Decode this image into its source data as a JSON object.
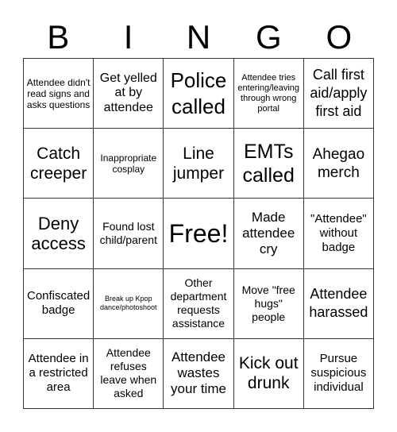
{
  "header": {
    "letters": [
      "B",
      "I",
      "N",
      "G",
      "O"
    ]
  },
  "cells": [
    [
      "Attendee didn't read signs and asks questions",
      "Get yelled at by attendee",
      "Police called",
      "Attendee tries entering/leaving through wrong portal",
      "Call first aid/apply first aid"
    ],
    [
      "Catch creeper",
      "Inappropriate cosplay",
      "Line jumper",
      "EMTs called",
      "Ahegao merch"
    ],
    [
      "Deny access",
      "Found lost child/parent",
      "Free!",
      "Made attendee cry",
      "\"Attendee\" without badge"
    ],
    [
      "Confiscated badge",
      "Break up Kpop dance/photoshoot",
      "Other department requests assistance",
      "Move \"free hugs\" people",
      "Attendee harassed"
    ],
    [
      "Attendee in a restricted area",
      "Attendee refuses leave when asked",
      "Attendee wastes your time",
      "Kick out drunk",
      "Pursue suspicious individual"
    ]
  ]
}
